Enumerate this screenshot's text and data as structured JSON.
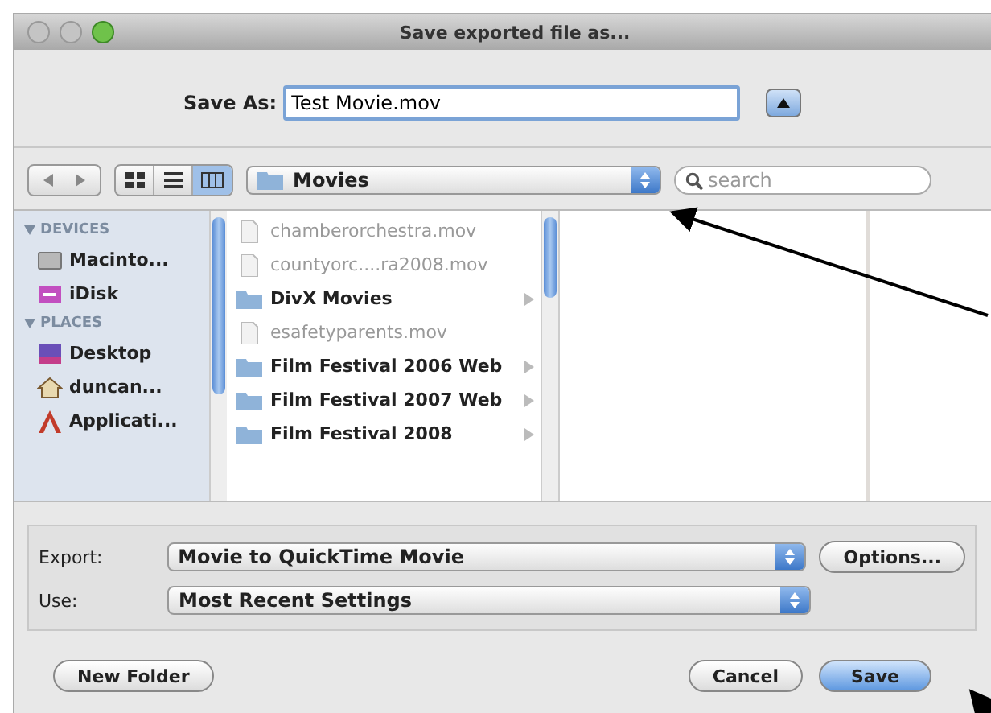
{
  "window": {
    "title": "Save exported file as..."
  },
  "save_as": {
    "label": "Save As:",
    "value": "Test Movie.mov",
    "expanded": false
  },
  "toolbar": {
    "view_modes": [
      {
        "kind": "icon",
        "selected": false
      },
      {
        "kind": "list",
        "selected": false
      },
      {
        "kind": "column",
        "selected": true
      }
    ],
    "location": "Movies",
    "search": {
      "placeholder": "search"
    }
  },
  "sidebar": {
    "sections": [
      {
        "title": "DEVICES",
        "items": [
          {
            "kind": "disk",
            "label": "Macinto..."
          },
          {
            "kind": "idisk",
            "label": "iDisk"
          }
        ]
      },
      {
        "title": "PLACES",
        "items": [
          {
            "kind": "desktop",
            "label": "Desktop"
          },
          {
            "kind": "home",
            "label": "duncan..."
          },
          {
            "kind": "apps",
            "label": "Applicati..."
          }
        ]
      }
    ]
  },
  "files": [
    {
      "kind": "file",
      "name": "chamberorchestra.mov"
    },
    {
      "kind": "file",
      "name": "countyorc....ra2008.mov"
    },
    {
      "kind": "folder",
      "name": "DivX Movies"
    },
    {
      "kind": "file",
      "name": "esafetyparents.mov"
    },
    {
      "kind": "folder",
      "name": "Film Festival 2006 Web"
    },
    {
      "kind": "folder",
      "name": "Film Festival 2007 Web"
    },
    {
      "kind": "folder",
      "name": "Film Festival 2008"
    }
  ],
  "export": {
    "label": "Export:",
    "value": "Movie to QuickTime Movie",
    "options_button": "Options..."
  },
  "use": {
    "label": "Use:",
    "value": "Most Recent Settings"
  },
  "buttons": {
    "new_folder": "New Folder",
    "cancel": "Cancel",
    "save": "Save"
  }
}
